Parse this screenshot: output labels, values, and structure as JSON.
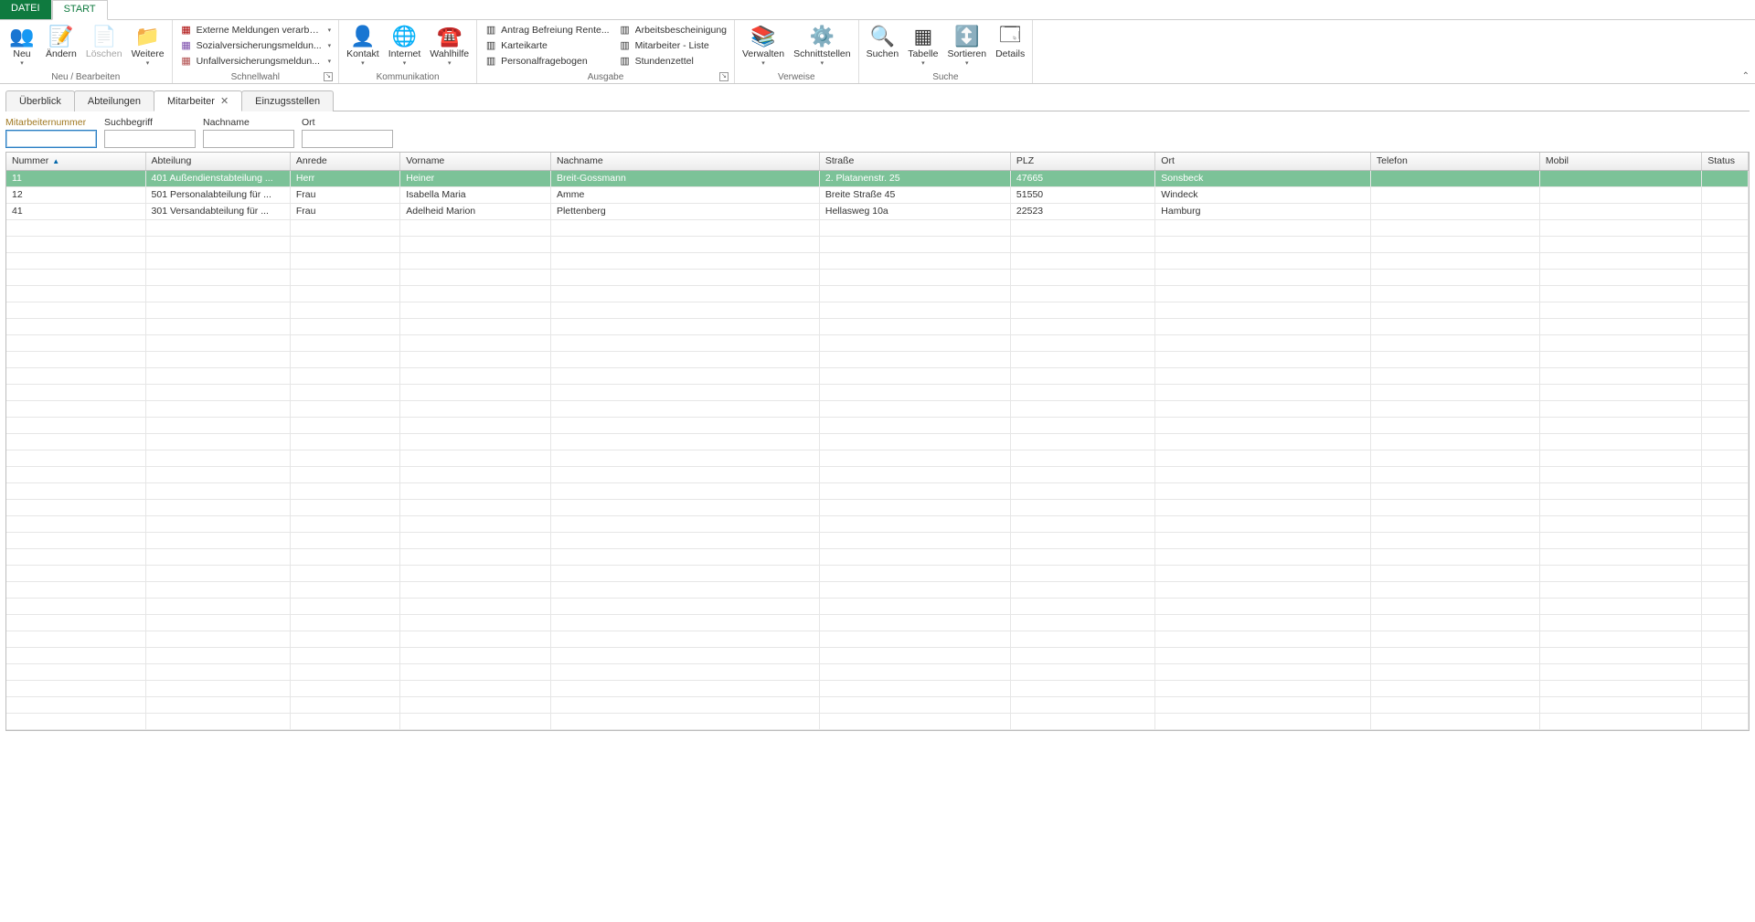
{
  "topTabs": {
    "datei": "DATEI",
    "start": "START"
  },
  "ribbon": {
    "groups": {
      "neuBearbeiten": {
        "label": "Neu / Bearbeiten",
        "neu": "Neu",
        "aendern": "Ändern",
        "loeschen": "Löschen",
        "weitere": "Weitere"
      },
      "schnellwahl": {
        "label": "Schnellwahl",
        "items": [
          "Externe Meldungen verarbei...",
          "Sozialversicherungsmeldun...",
          "Unfallversicherungsmeldun..."
        ]
      },
      "kommunikation": {
        "label": "Kommunikation",
        "kontakt": "Kontakt",
        "internet": "Internet",
        "wahlhilfe": "Wahlhilfe"
      },
      "ausgabe": {
        "label": "Ausgabe",
        "col1": [
          "Antrag Befreiung Rente...",
          "Karteikarte",
          "Personalfragebogen"
        ],
        "col2": [
          "Arbeitsbescheinigung",
          "Mitarbeiter - Liste",
          "Stundenzettel"
        ]
      },
      "verweise": {
        "label": "Verweise",
        "verwalten": "Verwalten",
        "schnittstellen": "Schnittstellen"
      },
      "suche": {
        "label": "Suche",
        "suchen": "Suchen",
        "tabelle": "Tabelle",
        "sortieren": "Sortieren",
        "details": "Details"
      }
    }
  },
  "subtabs": {
    "ueberblick": "Überblick",
    "abteilungen": "Abteilungen",
    "mitarbeiter": "Mitarbeiter",
    "einzugsstellen": "Einzugsstellen"
  },
  "filters": {
    "mitarbeiternummer": {
      "label": "Mitarbeiternummer",
      "value": ""
    },
    "suchbegriff": {
      "label": "Suchbegriff",
      "value": ""
    },
    "nachname": {
      "label": "Nachname",
      "value": ""
    },
    "ort": {
      "label": "Ort",
      "value": ""
    }
  },
  "columns": {
    "nummer": "Nummer",
    "abteilung": "Abteilung",
    "anrede": "Anrede",
    "vorname": "Vorname",
    "nachname": "Nachname",
    "strasse": "Straße",
    "plz": "PLZ",
    "ort": "Ort",
    "telefon": "Telefon",
    "mobil": "Mobil",
    "status": "Status"
  },
  "rows": [
    {
      "nummer": "11",
      "abteilung": "401 Außendienstabteilung ...",
      "anrede": "Herr",
      "vorname": "Heiner",
      "nachname": "Breit-Gossmann",
      "strasse": "2. Platanenstr. 25",
      "plz": "47665",
      "ort": "Sonsbeck",
      "telefon": "",
      "mobil": "",
      "status": "",
      "selected": true
    },
    {
      "nummer": "12",
      "abteilung": "501 Personalabteilung für ...",
      "anrede": "Frau",
      "vorname": "Isabella Maria",
      "nachname": "Amme",
      "strasse": "Breite Straße 45",
      "plz": "51550",
      "ort": "Windeck",
      "telefon": "",
      "mobil": "",
      "status": ""
    },
    {
      "nummer": "41",
      "abteilung": "301 Versandabteilung für ...",
      "anrede": "Frau",
      "vorname": "Adelheid Marion",
      "nachname": "Plettenberg",
      "strasse": "Hellasweg 10a",
      "plz": "22523",
      "ort": "Hamburg",
      "telefon": "",
      "mobil": "",
      "status": ""
    }
  ],
  "emptyRows": 31
}
